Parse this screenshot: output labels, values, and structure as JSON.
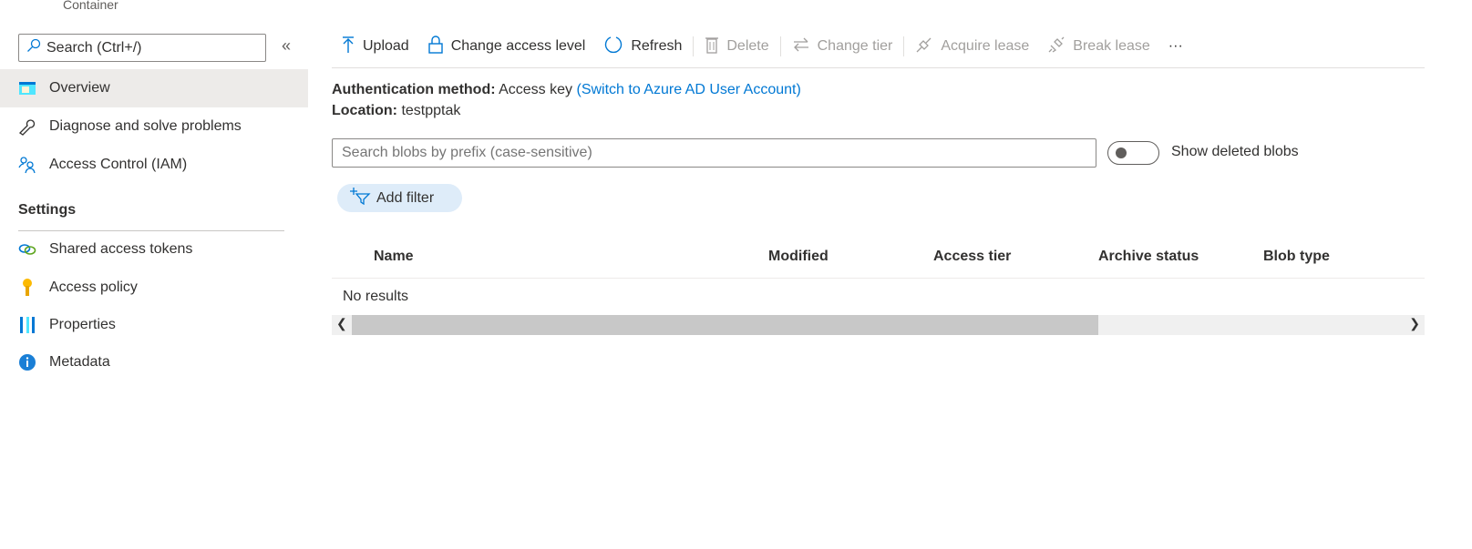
{
  "breadcrumb": "Container",
  "sidebar": {
    "search_placeholder": "Search (Ctrl+/)",
    "collapse": "«",
    "items": [
      {
        "label": "Overview",
        "icon": "overview-icon",
        "selected": true
      },
      {
        "label": "Diagnose and solve problems",
        "icon": "wrench-icon"
      },
      {
        "label": "Access Control (IAM)",
        "icon": "people-icon"
      }
    ],
    "settings_heading": "Settings",
    "settings_items": [
      {
        "label": "Shared access tokens",
        "icon": "link-icon"
      },
      {
        "label": "Access policy",
        "icon": "key-icon"
      },
      {
        "label": "Properties",
        "icon": "properties-icon"
      },
      {
        "label": "Metadata",
        "icon": "info-icon"
      }
    ]
  },
  "toolbar": {
    "upload": "Upload",
    "change_access": "Change access level",
    "refresh": "Refresh",
    "delete": "Delete",
    "change_tier": "Change tier",
    "acquire_lease": "Acquire lease",
    "break_lease": "Break lease",
    "more": "···"
  },
  "info": {
    "auth_label": "Authentication method:",
    "auth_value": "Access key",
    "auth_link": "(Switch to Azure AD User Account)",
    "location_label": "Location:",
    "location_value": "testpptak"
  },
  "blob_search": {
    "placeholder": "Search blobs by prefix (case-sensitive)",
    "value": ""
  },
  "show_deleted": {
    "label": "Show deleted blobs",
    "on": false
  },
  "add_filter": "Add filter",
  "table": {
    "columns": [
      "Name",
      "Modified",
      "Access tier",
      "Archive status",
      "Blob type"
    ],
    "empty": "No results"
  },
  "colors": {
    "accent": "#0078d4",
    "selected_bg": "#edebe9",
    "filter_bg": "#deecf9"
  }
}
